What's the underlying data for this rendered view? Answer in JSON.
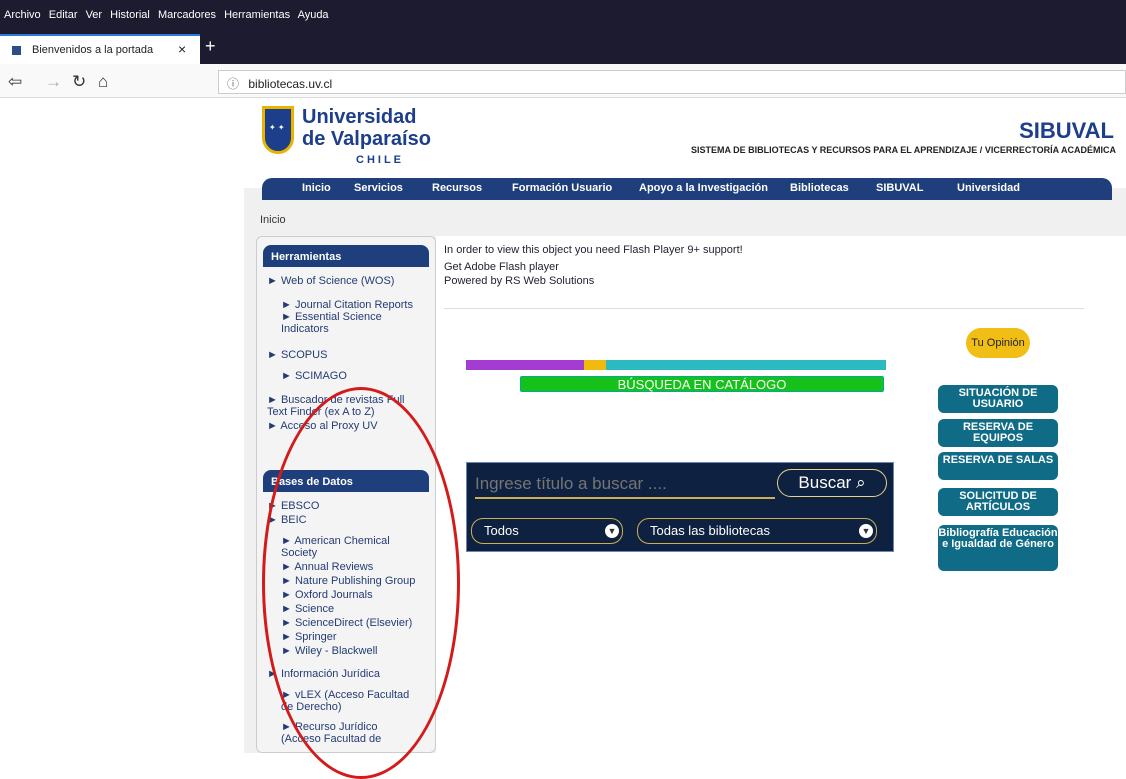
{
  "browser": {
    "menu": [
      "Archivo",
      "Editar",
      "Ver",
      "Historial",
      "Marcadores",
      "Herramientas",
      "Ayuda"
    ],
    "tab_title": "Bienvenidos a la portada",
    "url": "bibliotecas.uv.cl",
    "close_icon": "close-icon",
    "new_tab_icon": "plus-icon"
  },
  "header": {
    "logo_line1": "Universidad",
    "logo_line2": "de Valparaíso",
    "logo_line3": "CHILE",
    "brand": "SIBUVAL",
    "subtitle": "SISTEMA DE BIBLIOTECAS Y RECURSOS PARA EL APRENDIZAJE / VICERRECTORÍA ACADÉMICA"
  },
  "nav": [
    "Inicio",
    "Servicios",
    "Recursos",
    "Formación Usuario",
    "Apoyo a la Investigación",
    "Bibliotecas",
    "SIBUVAL",
    "Universidad"
  ],
  "breadcrumb": "Inicio",
  "sidebar": {
    "tools_title": "Herramientas",
    "tools": [
      "Web of Science (WOS)",
      "Journal Citation Reports",
      "Essential Science Indicators",
      "SCOPUS",
      "SCIMAGO",
      "Buscador de revistas Full Text Finder (ex A to Z)",
      "Acceso al Proxy UV"
    ],
    "db_title": "Bases de Datos",
    "databases": [
      "EBSCO",
      "BEIC",
      "American Chemical Society",
      "Annual Reviews",
      "Nature Publishing Group",
      "Oxford Journals",
      "Science",
      "ScienceDirect (Elsevier)",
      "Springer",
      "Wiley - Blackwell",
      "Información Jurídica",
      "vLEX (Acceso Facultad de Derecho)",
      "Recurso Jurídico (Acceso Facultad de"
    ]
  },
  "content": {
    "flash_message": "In order to view this object you need Flash Player 9+ support!",
    "get_flash": "Get Adobe Flash player",
    "powered_by": "Powered by RS Web Solutions",
    "catalog_button": "BÚSQUEDA EN CATÁLOGO",
    "search_placeholder": "Ingrese título a buscar ....",
    "search_button": "Buscar",
    "select_scope": "Todos",
    "select_library": "Todas las bibliotecas"
  },
  "right_panel": {
    "opinion": "Tu Opinión",
    "buttons": [
      "SITUACIÓN DE USUARIO",
      "RESERVA DE EQUIPOS",
      "RESERVA DE SALAS",
      "SOLICITUD DE ARTÍCULOS",
      "Bibliografía Educación e Igualdad de Género"
    ]
  },
  "colors": {
    "menu_bar": "#1c1b2f",
    "nav_blue": "#1e3e7c",
    "teal_button": "#0f6b86",
    "annotation_circle": "#d31b1b",
    "catalog_green": "#16c21a"
  }
}
